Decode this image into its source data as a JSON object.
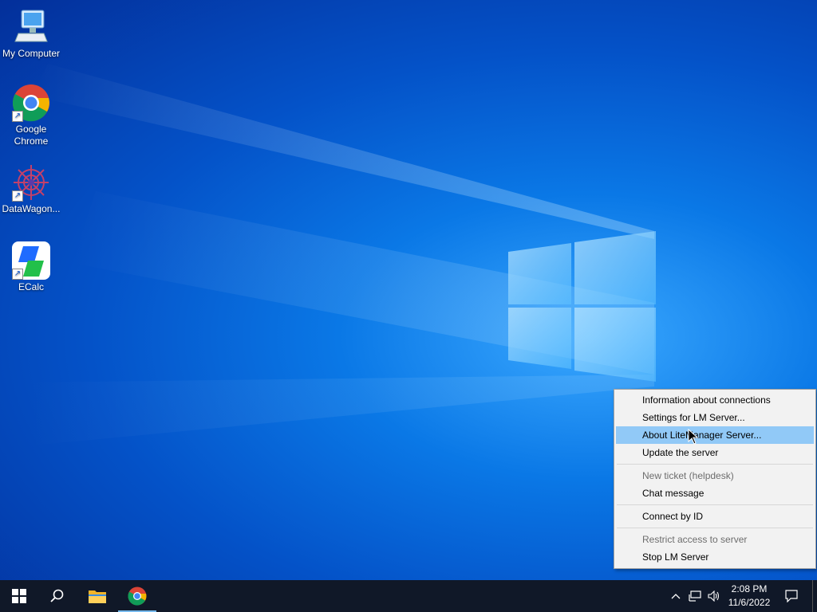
{
  "desktop": {
    "icons": [
      {
        "label": "My Computer",
        "icon": "computer-icon"
      },
      {
        "label": "Google Chrome",
        "icon": "chrome-icon"
      },
      {
        "label": "DataWagon...",
        "icon": "datawagon-icon"
      },
      {
        "label": "ECalc",
        "icon": "ecalc-icon"
      }
    ]
  },
  "context_menu": {
    "items": [
      {
        "label": "Information about connections",
        "enabled": true
      },
      {
        "label": "Settings for LM Server...",
        "enabled": true
      },
      {
        "label": "About LiteManager Server...",
        "enabled": true,
        "highlighted": true
      },
      {
        "label": "Update the server",
        "enabled": true
      },
      {
        "label": "New ticket (helpdesk)",
        "enabled": false
      },
      {
        "label": "Chat message",
        "enabled": true
      },
      {
        "label": "Connect by ID",
        "enabled": true
      },
      {
        "label": "Restrict access to server",
        "enabled": false
      },
      {
        "label": "Stop LM Server",
        "enabled": true
      }
    ]
  },
  "taskbar": {
    "buttons": [
      "start-icon",
      "search-icon",
      "file-explorer-icon",
      "chrome-icon"
    ],
    "tray": [
      "chevron-up-icon",
      "network-icon",
      "volume-icon"
    ],
    "time": "2:08 PM",
    "date": "11/6/2022",
    "notification_icon": "action-center-icon"
  },
  "colors": {
    "taskbar": "#101828",
    "menu_background": "#f2f2f2",
    "menu_highlight": "#91c9f7",
    "desktop_accent": "#0a78e6"
  }
}
